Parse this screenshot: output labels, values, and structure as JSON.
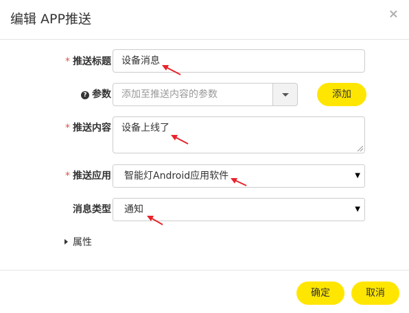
{
  "dialog": {
    "title": "编辑 APP推送",
    "close_glyph": "×"
  },
  "form": {
    "required_mark": "*",
    "push_title": {
      "label": "推送标题",
      "value": "设备消息"
    },
    "params": {
      "help_icon": "?",
      "label": "参数",
      "placeholder": "添加至推送内容的参数",
      "add_label": "添加"
    },
    "push_content": {
      "label": "推送内容",
      "value": "设备上线了"
    },
    "push_app": {
      "label": "推送应用",
      "value": "智能灯Android应用软件",
      "caret": "▼"
    },
    "message_type": {
      "label": "消息类型",
      "value": "通知",
      "caret": "▼"
    },
    "attributes": {
      "label": "属性"
    }
  },
  "footer": {
    "confirm_label": "确定",
    "cancel_label": "取消"
  },
  "colors": {
    "accent": "#ffe600",
    "required": "#d9534f",
    "annotation_arrow": "#e8232b"
  }
}
